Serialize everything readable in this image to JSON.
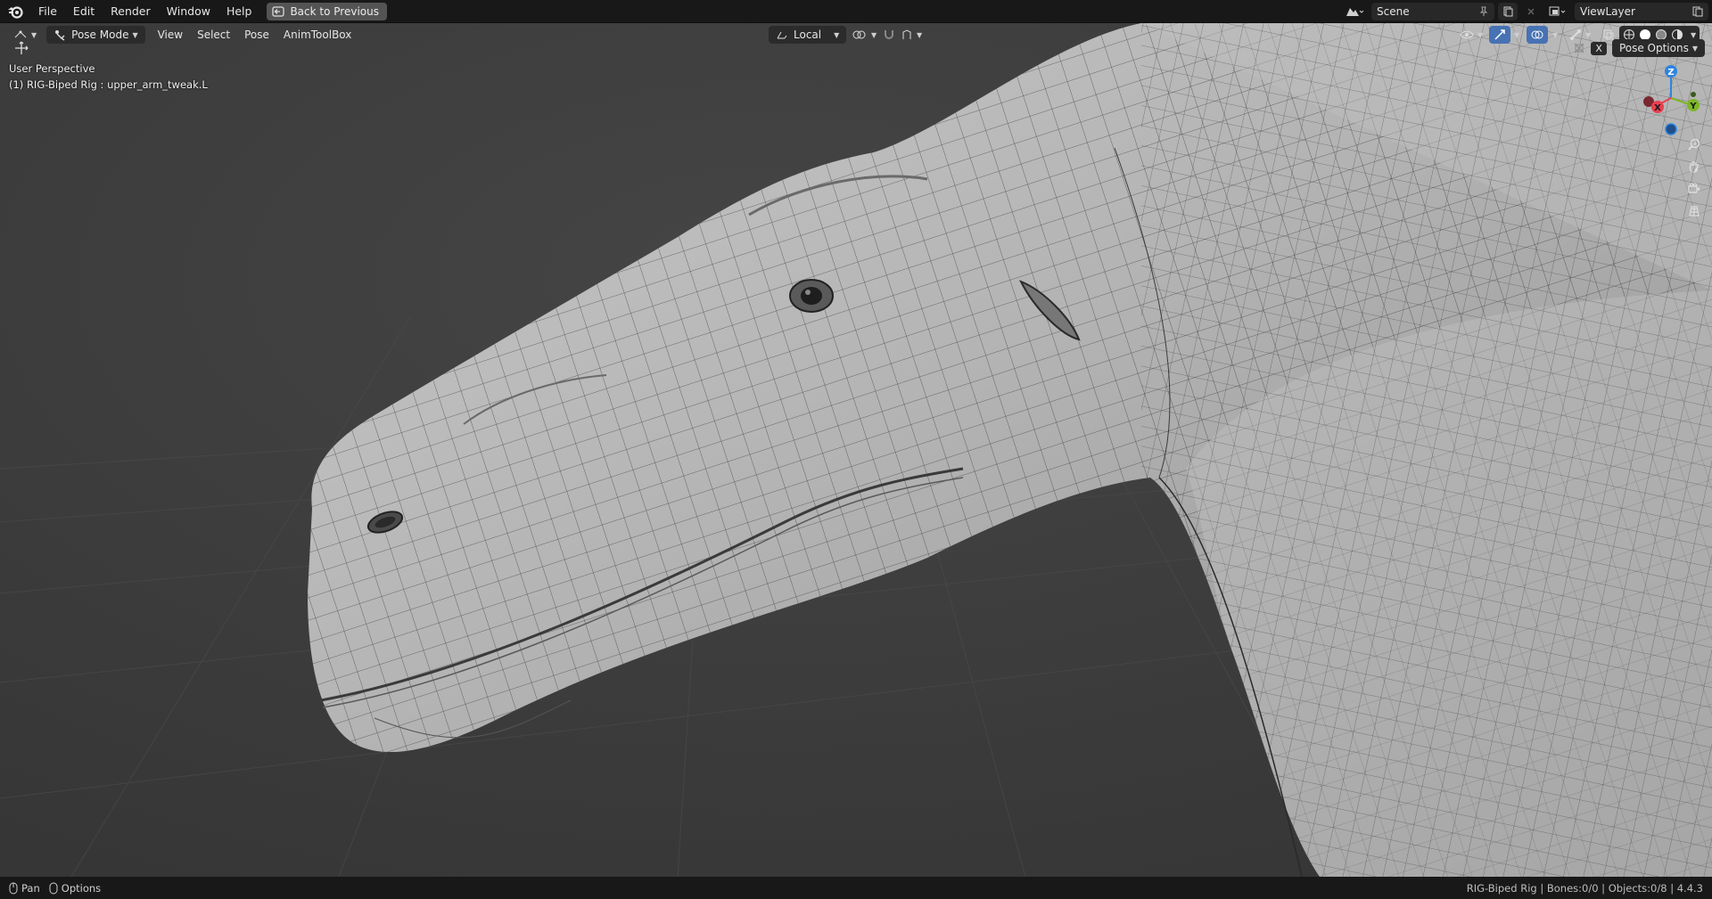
{
  "topbar": {
    "menus": [
      "File",
      "Edit",
      "Render",
      "Window",
      "Help"
    ],
    "back_button_label": "Back to Previous",
    "scene_name": "Scene",
    "view_layer_name": "ViewLayer"
  },
  "viewport_header": {
    "mode_label": "Pose Mode",
    "menus": [
      "View",
      "Select",
      "Pose",
      "AnimToolBox"
    ],
    "transform_orientation": "Local",
    "pose_options_label": "Pose Options",
    "x_label": "X"
  },
  "viewport_overlay": {
    "view_name": "User Perspective",
    "active_object": "(1) RIG-Biped Rig : upper_arm_tweak.L"
  },
  "gizmo": {
    "z_label": "Z",
    "x_label": "X",
    "y_label": "Y",
    "colors": {
      "x": "#e8404f",
      "y": "#7cb627",
      "z": "#2f84e0"
    }
  },
  "statusbar": {
    "left_items": [
      "Pan",
      "Options"
    ],
    "info": "RIG-Biped Rig | Bones:0/0 | Objects:0/8 | 4.4.3"
  },
  "icons": {
    "logo": "blender-logo-icon",
    "back": "back-arrow-icon",
    "nav": [
      "zoom-icon",
      "hand-pan-icon",
      "camera-icon",
      "grid-icon"
    ]
  }
}
